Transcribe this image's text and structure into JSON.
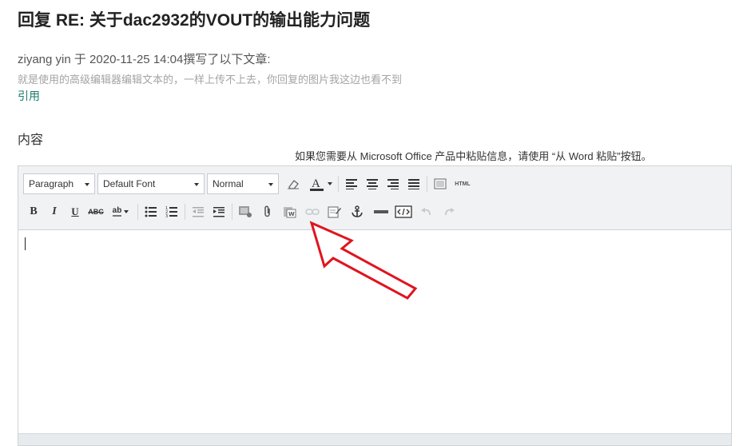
{
  "post": {
    "title": "回复 RE: 关于dac2932的VOUT的输出能力问题",
    "quote_header": "ziyang yin 于 2020-11-25 14:04撰写了以下文章:",
    "quote_body": "就是使用的高级编辑器编辑文本的，一样上传不上去，你回复的图片我这边也看不到",
    "quote_link": "引用"
  },
  "form": {
    "content_label": "内容",
    "paste_hint": "如果您需要从 Microsoft Office 产品中粘贴信息，请使用 “从 Word 粘贴”按钮。"
  },
  "toolbar": {
    "format_select": "Paragraph",
    "font_select": "Default Font",
    "size_select": "Normal",
    "html_label": "HTML",
    "bold_label": "B",
    "italic_label": "I",
    "underline_label": "U",
    "strike_label": "ABC",
    "spell_label": "ab"
  },
  "icons": {
    "highlighted_tool": "insert-image-icon",
    "annotation": "red-arrow"
  },
  "colors": {
    "arrow": "#e0141e",
    "link": "#1a7a6c",
    "toolbar_bg": "#f0f2f4"
  }
}
